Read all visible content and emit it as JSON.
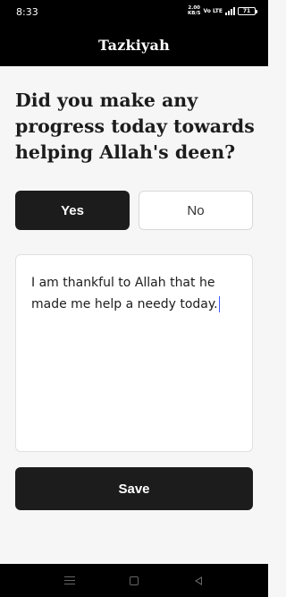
{
  "status_bar": {
    "time": "8:33",
    "speed_value": "2.00",
    "speed_unit": "KB/S",
    "network": "Vo LTE",
    "battery": "71"
  },
  "app_bar": {
    "title": "Tazkiyah"
  },
  "question": {
    "text": "Did you make any progress today towards helping Allah's deen?"
  },
  "options": {
    "yes_label": "Yes",
    "no_label": "No",
    "selected": "Yes"
  },
  "answer": {
    "value": "I am thankful to Allah that he made me help a needy today."
  },
  "save_label": "Save",
  "icons": {
    "nav_menu": "menu-lines-icon",
    "nav_home": "square-home-icon",
    "nav_back": "triangle-back-icon"
  },
  "colors": {
    "primary": "#1c1c1c",
    "background": "#f6f6f6",
    "bars": "#000000"
  }
}
